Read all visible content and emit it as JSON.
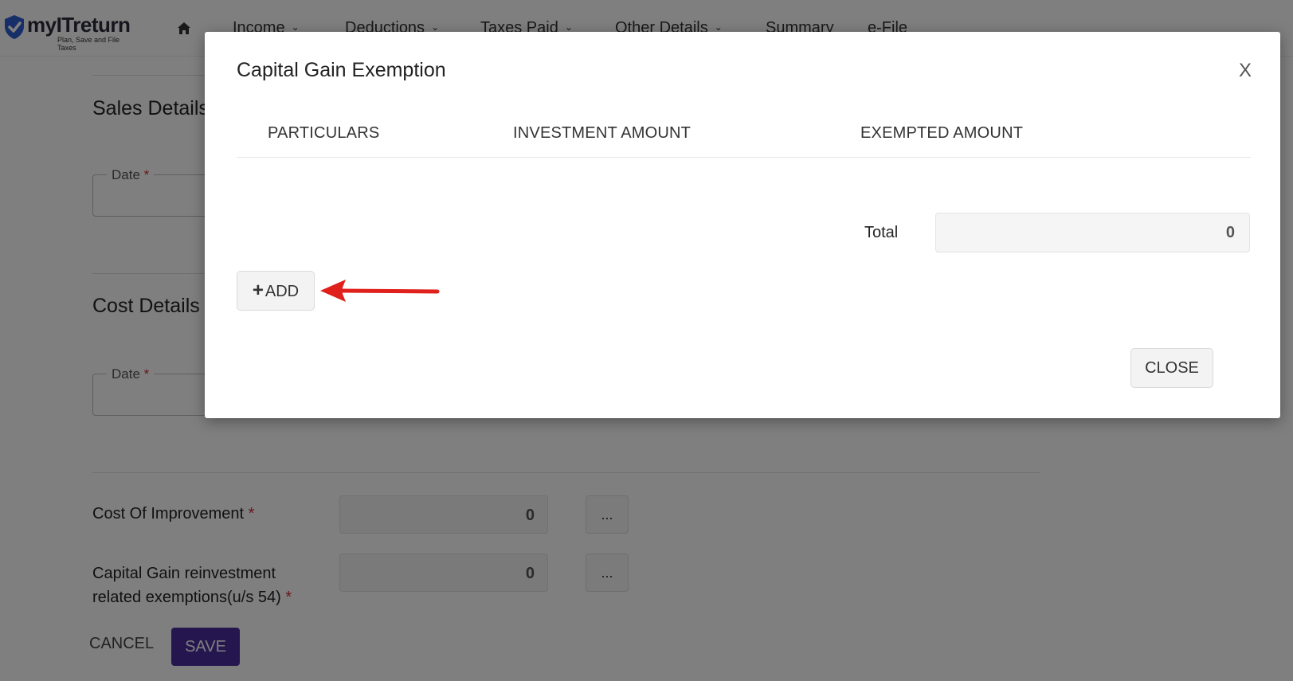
{
  "nav": {
    "logo_text": "myITreturn",
    "logo_tagline": "Plan, Save and File Taxes",
    "items": [
      {
        "label": "Income",
        "has_dropdown": true
      },
      {
        "label": "Deductions",
        "has_dropdown": true
      },
      {
        "label": "Taxes Paid",
        "has_dropdown": true
      },
      {
        "label": "Other Details",
        "has_dropdown": true
      },
      {
        "label": "Summary",
        "has_dropdown": false
      },
      {
        "label": "e-File",
        "has_dropdown": false
      }
    ],
    "chevron": "⌄"
  },
  "page": {
    "sales_title": "Sales Details",
    "sales_date_label": "Date",
    "cost_title": "Cost Details",
    "cost_date_label": "Date",
    "required_mark": "*",
    "cost_of_improvement_label": "Cost Of Improvement",
    "cost_of_improvement_value": "0",
    "reinvestment_label_line1": "Capital Gain reinvestment",
    "reinvestment_label_line2": "related exemptions(u/s 54)",
    "reinvestment_value": "0",
    "dots_label": "...",
    "cancel_label": "CANCEL",
    "save_label": "SAVE"
  },
  "modal": {
    "title": "Capital Gain Exemption",
    "close_x": "X",
    "columns": [
      "PARTICULARS",
      "INVESTMENT AMOUNT",
      "EXEMPTED AMOUNT"
    ],
    "total_label": "Total",
    "total_value": "0",
    "add_plus": "+",
    "add_label": "ADD",
    "close_label": "CLOSE"
  },
  "colors": {
    "brand_primary": "#4b2c9f",
    "logo_check": "#2f5fd0",
    "annotation_arrow": "#e0201b",
    "required": "#d32f2f",
    "overlay": "rgba(0,0,0,0.5)"
  },
  "icons": {
    "home": "home-icon",
    "logo": "shield-check-icon",
    "annotation": "red-arrow-annotation"
  }
}
